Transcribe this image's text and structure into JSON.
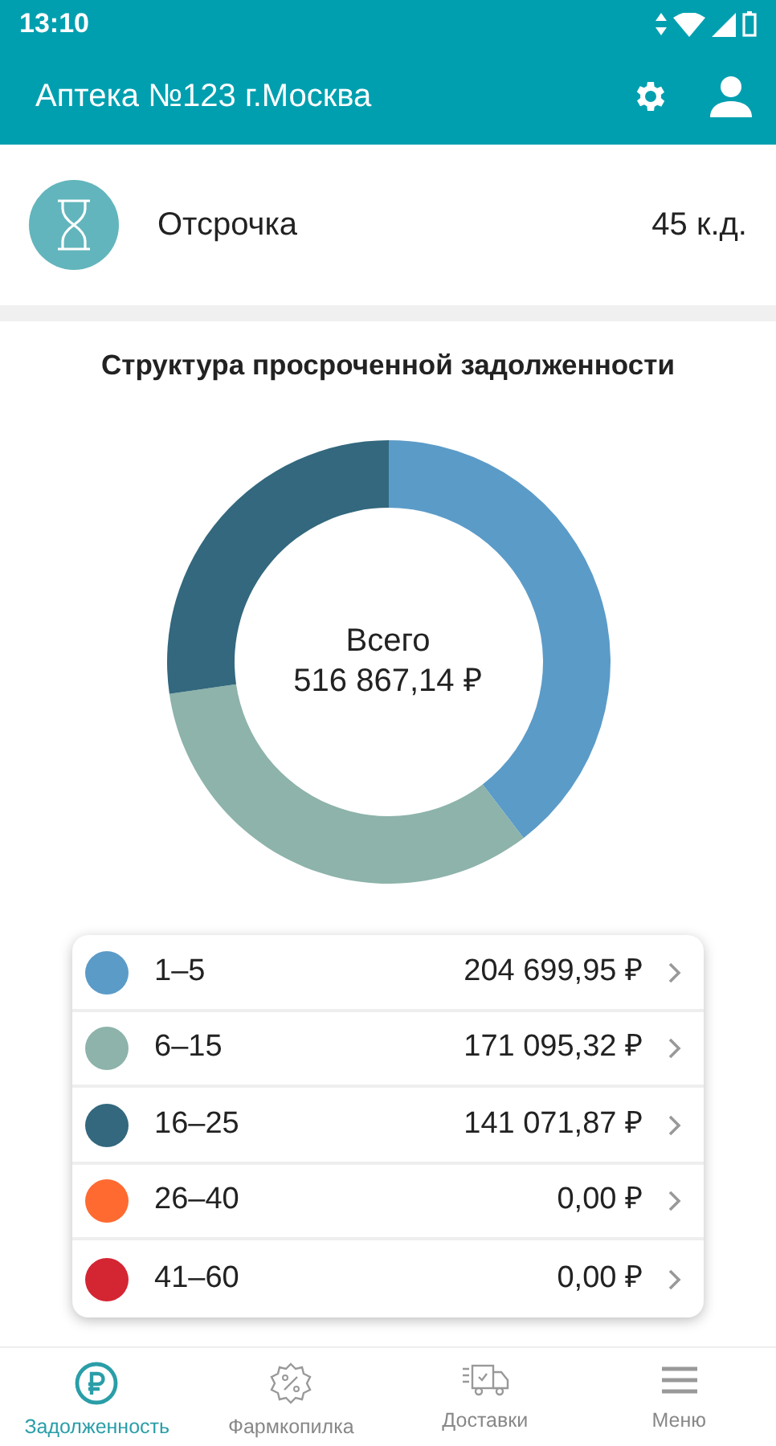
{
  "status_bar": {
    "time": "13:10"
  },
  "app_bar": {
    "title": "Аптека №123 г.Москва"
  },
  "deferral": {
    "label": "Отсрочка",
    "value": "45 к.д."
  },
  "debt_structure": {
    "title": "Структура просроченной задолженности",
    "chart_data": {
      "type": "donut",
      "categories": [
        "1–5",
        "6–15",
        "16–25",
        "26–40",
        "41–60"
      ],
      "values": [
        39.6,
        33.1,
        27.3,
        0,
        0
      ]
    },
    "total_label": "Всего",
    "total_value": "516 867,14 ₽",
    "legend": [
      {
        "amount": "204 699,95 ₽",
        "color": "#5b9bc8"
      },
      {
        "amount": "171 095,32 ₽",
        "color": "#8db3aa"
      },
      {
        "amount": "141 071,87 ₽",
        "color": "#33687e"
      },
      {
        "amount": "0,00 ₽",
        "color": "#ff6a30"
      },
      {
        "amount": "0,00 ₽",
        "color": "#d42533"
      }
    ]
  },
  "bottom_nav": [
    {
      "kind": "ruble",
      "label": "Задолженность",
      "selected": true
    },
    {
      "kind": "percent",
      "label": "Фармкопилка",
      "selected": false
    },
    {
      "kind": "truck",
      "label": "Доставки",
      "selected": false
    },
    {
      "kind": "menu",
      "label": "Меню",
      "selected": false
    }
  ]
}
